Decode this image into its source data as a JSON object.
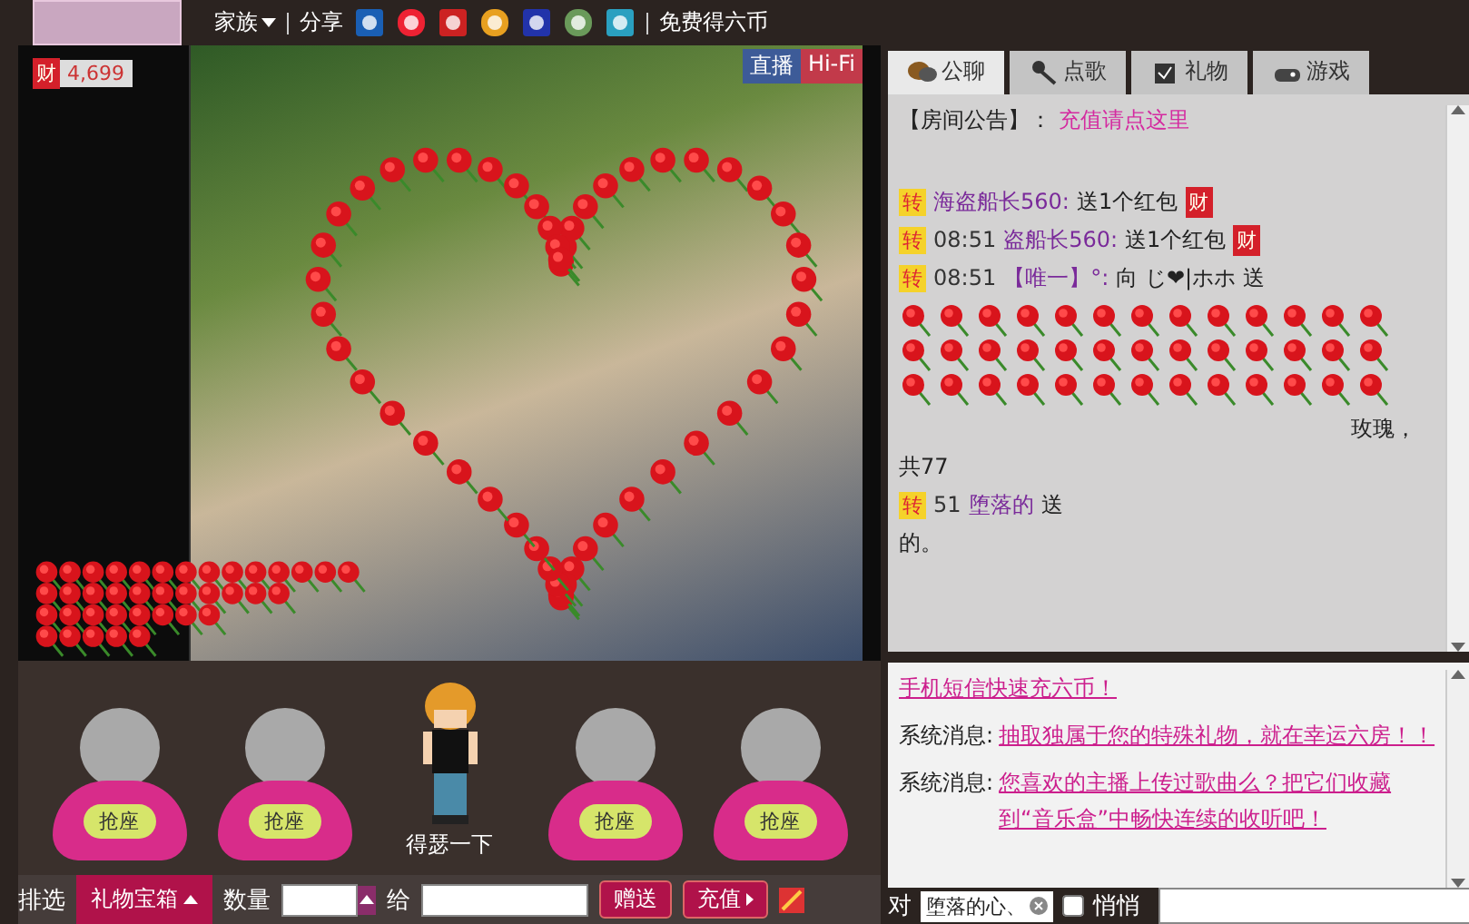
{
  "header": {
    "nav": [
      {
        "label": "家族",
        "kind": "dropdown"
      },
      {
        "label": "分享",
        "kind": "plain"
      }
    ],
    "free_coins": "免费得六币"
  },
  "wealth": {
    "badge": "财",
    "value": "4,699"
  },
  "video_badges": [
    {
      "label": "直播",
      "color": "#3d5b98"
    },
    {
      "label": "Hi-Fi",
      "color": "#c23a4a"
    }
  ],
  "seats": [
    {
      "kind": "empty",
      "button": "抢座"
    },
    {
      "kind": "empty",
      "button": "抢座"
    },
    {
      "kind": "occupied",
      "name": "得瑟一下"
    },
    {
      "kind": "empty",
      "button": "抢座"
    },
    {
      "kind": "empty",
      "button": "抢座"
    }
  ],
  "gift_bar": {
    "filter_label": "排选",
    "gift_tab": "礼物宝箱",
    "quantity_label": "数量",
    "to_label": "给",
    "send_button": "赠送",
    "recharge_button": "充值"
  },
  "chat_tabs": [
    {
      "label": "公聊",
      "selected": true
    },
    {
      "label": "点歌",
      "selected": false
    },
    {
      "label": "礼物",
      "selected": false
    },
    {
      "label": "游戏",
      "selected": false
    }
  ],
  "announcement": {
    "label": "【房间公告】：",
    "link": "充值请点这里"
  },
  "messages": [
    {
      "badge": "转",
      "sender": "海盗船长560:",
      "text": "送1个红包",
      "gift_badge": "财"
    },
    {
      "badge": "转",
      "time": "08:51",
      "sender": "盗船长560:",
      "text": "送1个红包",
      "gift_badge": "财"
    },
    {
      "badge": "转",
      "time": "08:51",
      "sender": "【唯一】°:",
      "text": "向 じ❤|ホホ 送",
      "roses": true,
      "tail": "玫瑰，",
      "extra": "共77"
    },
    {
      "badge": "转",
      "time": "51",
      "sender": "堕落的",
      "text": "送",
      "extra": "的。"
    }
  ],
  "system_messages": [
    {
      "link": "手机短信快速充六币！"
    },
    {
      "prefix": "系统消息:",
      "link": "抽取独属于您的特殊礼物，就在幸运六房！！"
    },
    {
      "prefix": "系统消息:",
      "link": "您喜欢的主播上传过歌曲么？把它们收藏到“音乐盒”中畅快连续的收听吧！"
    }
  ],
  "whisper_bar": {
    "to_label": "对",
    "target": "堕落的心、",
    "whisper_label": "悄悄",
    "whisper_checked": false
  }
}
